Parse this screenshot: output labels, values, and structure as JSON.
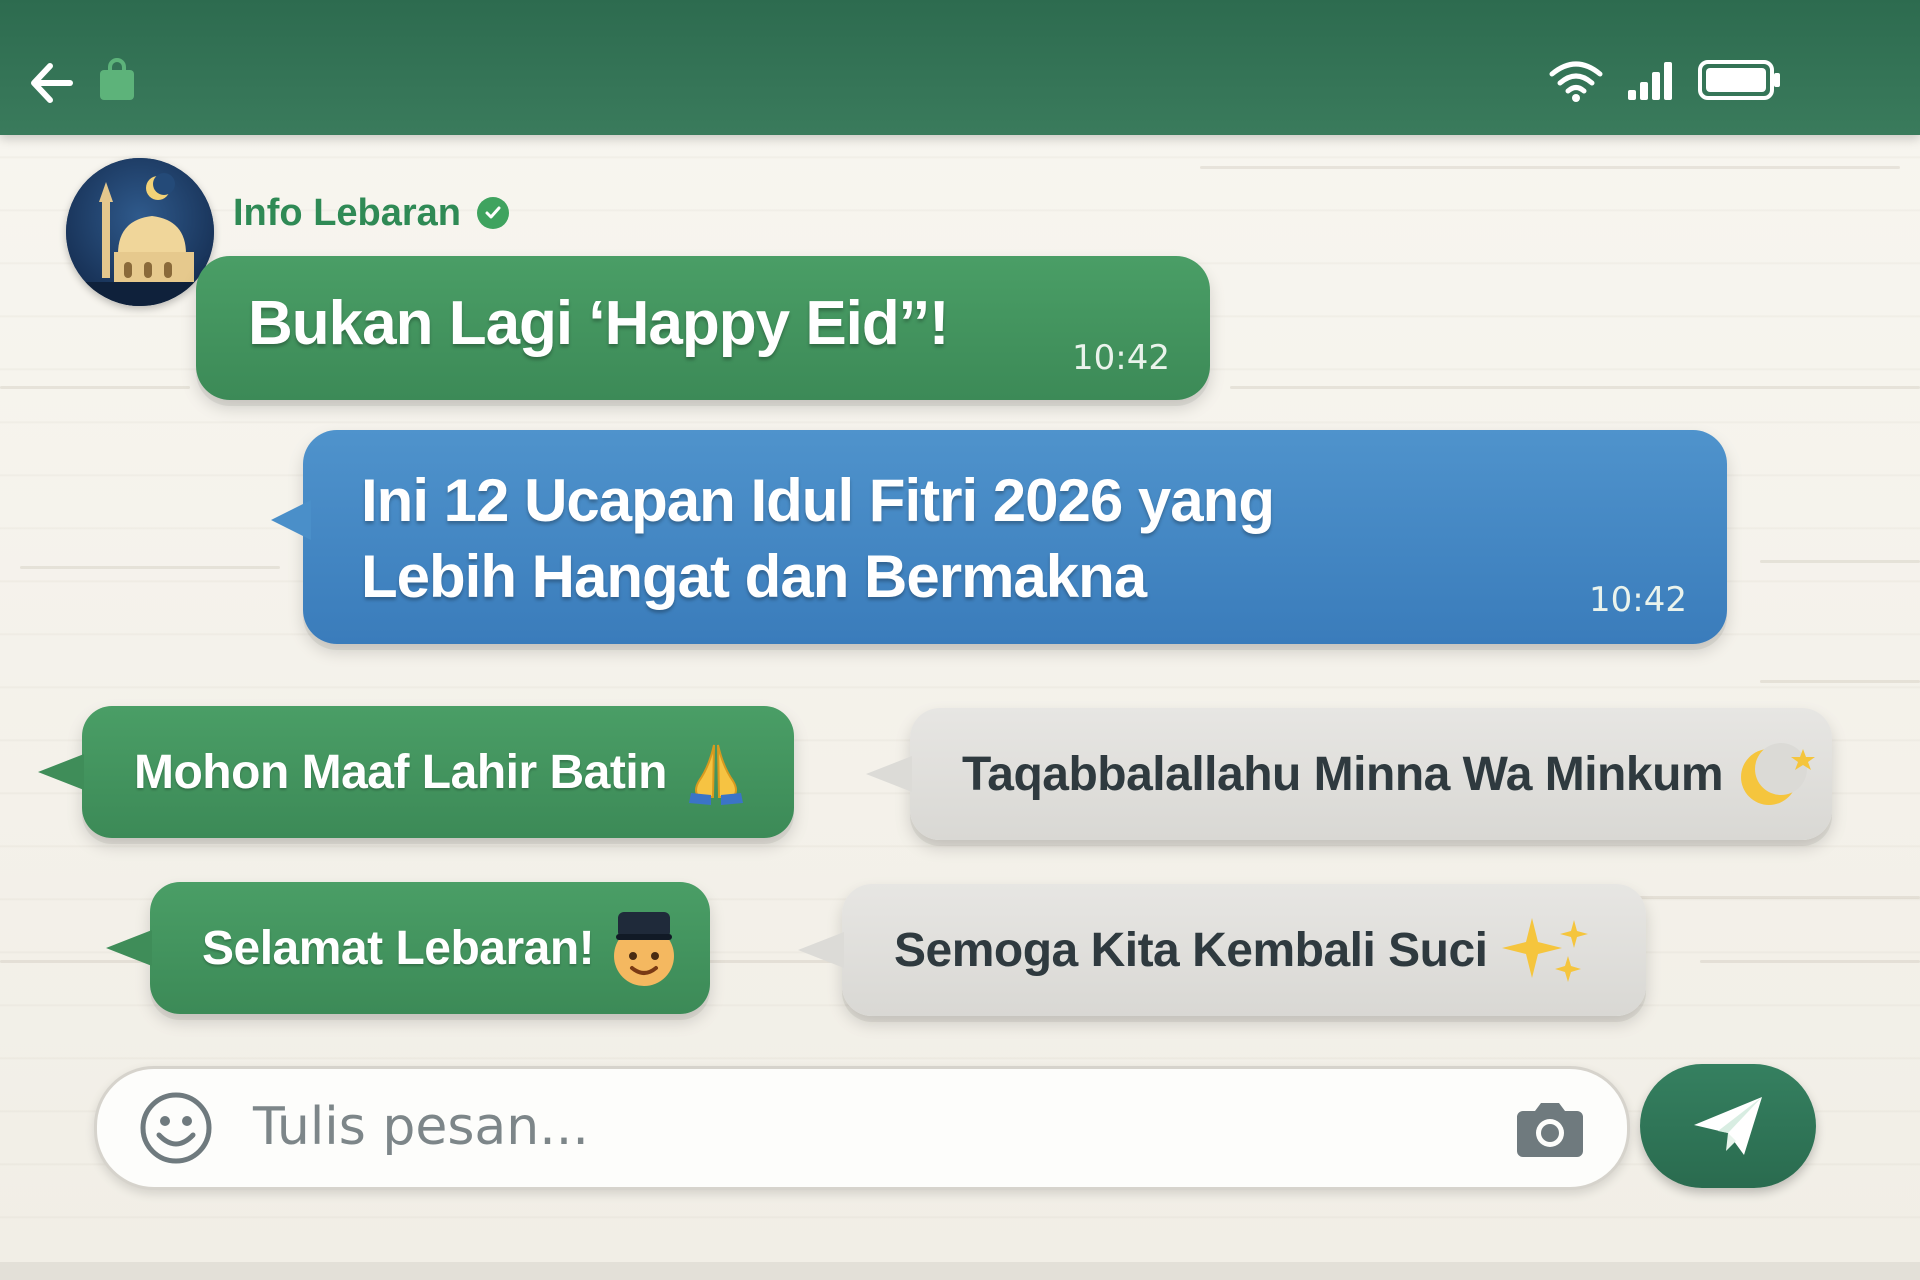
{
  "status_bar": {
    "icons": [
      "back-arrow-icon",
      "shopping-bag-icon",
      "wifi-icon",
      "signal-icon",
      "battery-icon"
    ]
  },
  "chat_header": {
    "name": "Info Lebaran",
    "verified": true,
    "avatar": "mosque-crescent-avatar"
  },
  "messages": [
    {
      "text": "Bukan Lagi ‘Happy Eid’’!",
      "time": "10:42"
    },
    {
      "lines": [
        "Ini 12 Ucapan Idul Fitri 2026 yang",
        "Lebih Hangat dan Bermakna"
      ],
      "time": "10:42"
    }
  ],
  "greeting_chips": [
    {
      "text": "Mohon Maaf Lahir Batin",
      "emoji": "🙏",
      "color": "green"
    },
    {
      "text": "Taqabbalallahu Minna Wa Minkum",
      "emoji": "🌙✨",
      "color": "grey"
    },
    {
      "text": "Selamat Lebaran!",
      "emoji": "👦",
      "color": "green"
    },
    {
      "text": "Semoga Kita Kembali Suci",
      "emoji": "✨",
      "color": "grey"
    }
  ],
  "composer": {
    "placeholder": "Tulis pesan..."
  },
  "colors": {
    "top_bar": "#2d6b4f",
    "green_bubble": "#3f8d59",
    "blue_bubble": "#4485c3",
    "grey_bubble": "#dedcd8",
    "name": "#2f8a55"
  }
}
